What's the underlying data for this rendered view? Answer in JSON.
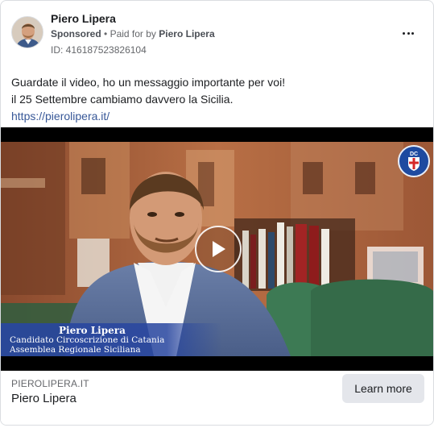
{
  "header": {
    "page_name": "Piero Lipera",
    "sponsored_label": "Sponsored",
    "separator": "•",
    "paid_for_label": "Paid for by",
    "paid_for_by": "Piero Lipera",
    "ad_id": "ID: 416187523826104",
    "more_icon": "more-horizontal-icon"
  },
  "post": {
    "line1": "Guardate il video, ho un messaggio importante per voi!",
    "line2": "il 25 Settembre cambiamo davvero la Sicilia.",
    "link": "https://pierolipera.it/"
  },
  "video": {
    "logo_text": "DC",
    "logo_sub": "DEMOCRAZIA CRISTIANA",
    "caption_name": "Piero Lipera",
    "caption_line1": "Candidato Circoscrizione di Catania",
    "caption_line2": "Assemblea Regionale Siciliana",
    "play_icon": "play-icon"
  },
  "footer": {
    "domain": "PIEROLIPERA.IT",
    "title": "Piero Lipera",
    "cta": "Learn more"
  },
  "colors": {
    "link": "#385898",
    "caption_bar": "#2846a0",
    "button_bg": "#e4e6eb"
  }
}
